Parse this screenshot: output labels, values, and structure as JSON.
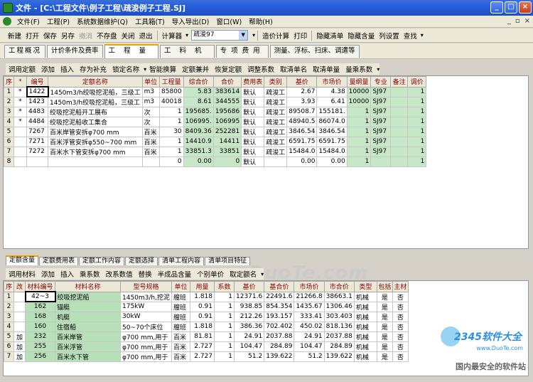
{
  "window": {
    "title": "文件 - [C:\\工程文件\\例子工程\\疏浚例子工程.SJ]",
    "controls": [
      "_",
      "□",
      "×"
    ]
  },
  "menu": [
    "文件(F)",
    "工程(P)",
    "系统数据维护(Q)",
    "工具箱(T)",
    "导入导出(D)",
    "窗口(W)",
    "帮助(H)"
  ],
  "mdi_controls": [
    "_",
    "▫",
    "×"
  ],
  "toolbar": {
    "left": [
      "新建",
      "打开",
      "保存",
      "另存",
      "撤消",
      "不存盘",
      "关闭",
      "退出"
    ],
    "disabled_index": 4,
    "calc": "计算器",
    "combo_value": "疏浚97",
    "right": [
      "造价计算",
      "打印"
    ],
    "right2": [
      "隐藏清单",
      "隐藏含量",
      "列设置",
      "查找"
    ]
  },
  "main_tabs": [
    "工程概况",
    "计价条件及费率",
    "工程量",
    "工料机",
    "专项费用",
    "测量、浮标、扫床、调遣等"
  ],
  "active_main_tab": 2,
  "upper_tools": [
    "调用定额",
    "添加",
    "插入",
    "存为补充",
    "锁定名称",
    "智能换算",
    "定额兼并",
    "恢复定额",
    "调整系数",
    "取清单名",
    "取清单量",
    "量乘系数"
  ],
  "upper_grid": {
    "headers": [
      "序",
      "*",
      "编号",
      "定额名称",
      "单位",
      "工程量",
      "综合价",
      "合价",
      "费用表",
      "类别",
      "基价",
      "市场价",
      "量纲量",
      "专业",
      "备注",
      "调价"
    ],
    "rows": [
      [
        "1",
        "*",
        "1422",
        "1450m3/h绞吸挖泥船，三级工",
        "m3",
        "85800",
        "5.83",
        "383614",
        "默认",
        "疏浚工",
        "2.67",
        "4.38",
        "10000",
        "SJ97",
        "",
        "1"
      ],
      [
        "2",
        "*",
        "1423",
        "1450m3/h绞吸挖泥船，三级工",
        "m3",
        "40018",
        "8.61",
        "344555",
        "默认",
        "疏浚工",
        "3.93",
        "6.41",
        "10000",
        "SJ97",
        "",
        "1"
      ],
      [
        "3",
        "*",
        "4483",
        "绞吸挖泥船开工展布",
        "次",
        "1",
        "195685.",
        "195686",
        "默认",
        "疏浚工",
        "89508.7",
        "155181.",
        "1",
        "SJ97",
        "",
        "1"
      ],
      [
        "4",
        "*",
        "4484",
        "绞吸挖泥船收工集合",
        "次",
        "1",
        "106995.",
        "106995",
        "默认",
        "疏浚工",
        "48940.5",
        "86074.0",
        "1",
        "SJ97",
        "",
        "1"
      ],
      [
        "5",
        "",
        "7267",
        "百米岸管安拆φ700 mm",
        "百米",
        "30",
        "8409.36",
        "252281",
        "默认",
        "疏浚工",
        "3846.54",
        "3846.54",
        "1",
        "SJ97",
        "",
        "1"
      ],
      [
        "6",
        "",
        "7271",
        "百米浮管安拆φ550~700 mm",
        "百米",
        "1",
        "14410.9",
        "14411",
        "默认",
        "疏浚工",
        "6591.75",
        "6591.75",
        "1",
        "SJ97",
        "",
        "1"
      ],
      [
        "7",
        "",
        "7272",
        "百米水下管安拆φ700 mm",
        "百米",
        "1",
        "33851.3",
        "33851",
        "默认",
        "疏浚工",
        "15484.0",
        "15484.0",
        "1",
        "SJ97",
        "",
        "1"
      ],
      [
        "8",
        "",
        "",
        "",
        "",
        "0",
        "0.00",
        "0",
        "默认",
        "",
        "0.00",
        "0.00",
        "1",
        "",
        "",
        "1"
      ]
    ]
  },
  "watermark": "www.DuoTe.com",
  "bottom_tabs": [
    "定额含量",
    "定额费用表",
    "定额工作内容",
    "定额选择",
    "清单工程内容",
    "清单项目特征"
  ],
  "active_bottom_tab": 0,
  "lower_tools": [
    "调用材料",
    "添加",
    "插入",
    "乘系数",
    "改系数值",
    "替换",
    "半成品含量",
    "个别单价",
    "取定额名"
  ],
  "lower_grid": {
    "headers": [
      "序",
      "改",
      "材料编号",
      "材料名称",
      "型号规格",
      "单位",
      "用量",
      "系数",
      "基价",
      "基合价",
      "市场价",
      "市合价",
      "类型",
      "包括",
      "主材"
    ],
    "rows": [
      [
        "1",
        "",
        "42~3",
        "绞吸挖泥船",
        "1450m3/h,挖泥",
        "艘班",
        "1.818",
        "1",
        "12371.6",
        "22491.6",
        "21266.8",
        "38663.1",
        "机械",
        "是",
        "否"
      ],
      [
        "2",
        "",
        "162",
        "锚艇",
        "175kW",
        "艘班",
        "0.91",
        "1",
        "938.85",
        "854.354",
        "1435.67",
        "1306.46",
        "机械",
        "是",
        "否"
      ],
      [
        "3",
        "",
        "168",
        "机艇",
        "30kW",
        "艘班",
        "0.91",
        "1",
        "212.26",
        "193.157",
        "333.41",
        "303.403",
        "机械",
        "是",
        "否"
      ],
      [
        "4",
        "",
        "160",
        "住宿船",
        "50~70个床位",
        "艘班",
        "1.818",
        "1",
        "386.36",
        "702.402",
        "450.02",
        "818.136",
        "机械",
        "是",
        "否"
      ],
      [
        "5",
        "加",
        "232",
        "百米岸管",
        "φ700 mm,用于",
        "百米",
        "81.81",
        "1",
        "24.91",
        "2037.88",
        "24.91",
        "2037.88",
        "机械",
        "是",
        "否"
      ],
      [
        "6",
        "加",
        "255",
        "百米浮管",
        "φ700 mm,用于",
        "百米",
        "2.727",
        "1",
        "104.47",
        "284.89",
        "104.47",
        "284.89",
        "机械",
        "是",
        "否"
      ],
      [
        "7",
        "加",
        "256",
        "百米水下管",
        "φ700 mm,用于",
        "百米",
        "2.727",
        "1",
        "51.2",
        "139.622",
        "51.2",
        "139.622",
        "机械",
        "是",
        "否"
      ]
    ]
  },
  "logo": {
    "brand": "2345软件大全",
    "site": "www.DuoTe.com",
    "slogan": "国内最安全的软件站"
  }
}
